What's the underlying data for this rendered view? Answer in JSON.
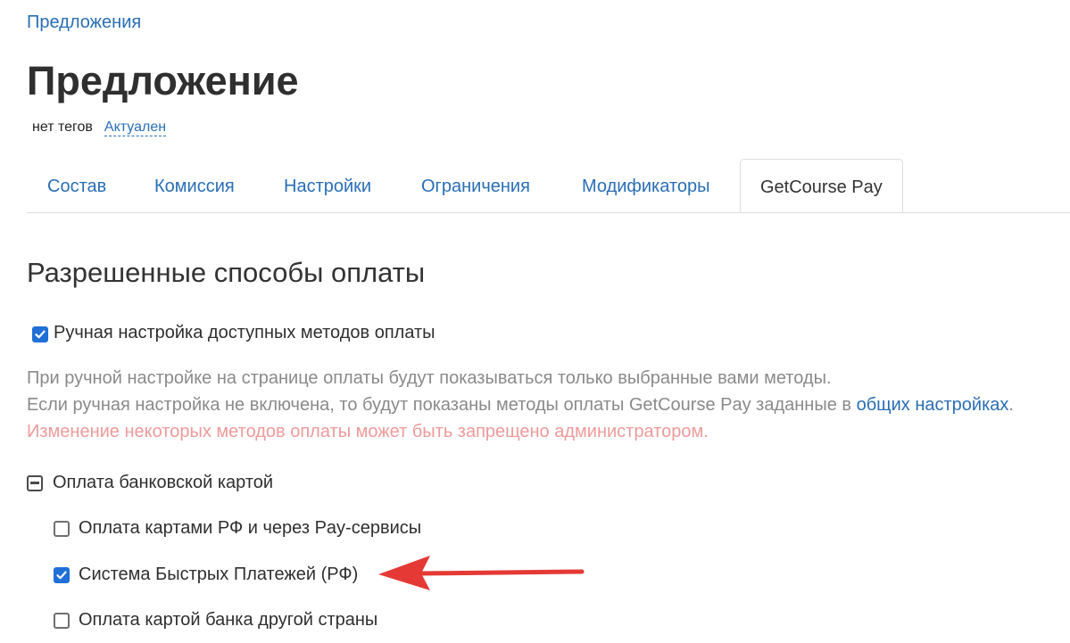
{
  "breadcrumb": {
    "label": "Предложения"
  },
  "header": {
    "title": "Предложение",
    "tags_text": "нет тегов",
    "status_label": "Актуален"
  },
  "tabs": [
    {
      "label": "Состав",
      "active": false
    },
    {
      "label": "Комиссия",
      "active": false
    },
    {
      "label": "Настройки",
      "active": false
    },
    {
      "label": "Ограничения",
      "active": false
    },
    {
      "label": "Модификаторы",
      "active": false
    },
    {
      "label": "GetCourse Pay",
      "active": true
    }
  ],
  "section": {
    "title": "Разрешенные способы оплаты",
    "manual_setup": {
      "label": "Ручная настройка доступных методов оплаты",
      "checked": true
    },
    "help": {
      "line1": "При ручной настройке на странице оплаты будут показываться только выбранные вами методы.",
      "line2_prefix": "Если ручная настройка не включена, то будут показаны методы оплаты GetCourse Pay заданные в ",
      "line2_link": "общих настройках",
      "line2_suffix": ".",
      "warning": "Изменение некоторых методов оплаты может быть запрещено администратором."
    },
    "group": {
      "label": "Оплата банковской картой",
      "expanded": true,
      "options": [
        {
          "label": "Оплата картами РФ и через Pay-сервисы",
          "checked": false
        },
        {
          "label": "Система Быстрых Платежей (РФ)",
          "checked": true
        },
        {
          "label": "Оплата картой банка другой страны",
          "checked": false
        }
      ]
    }
  },
  "colors": {
    "link": "#2a6eb5",
    "checkbox_checked": "#1f6fd6",
    "warning_text": "#ee9a9a",
    "help_text": "#8a8a8a",
    "arrow": "#e53935"
  },
  "icons": {
    "checkmark": "check-icon",
    "collapse": "minus-square-icon",
    "annotation": "arrow-left-icon"
  }
}
